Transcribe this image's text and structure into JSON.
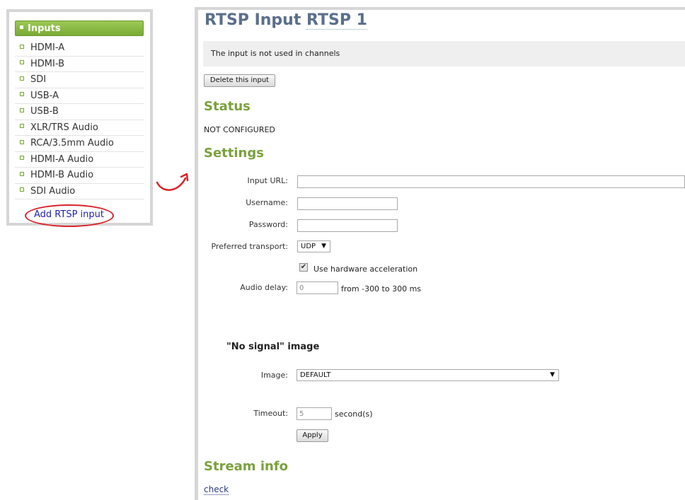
{
  "sidebar": {
    "header": "Inputs",
    "items": [
      {
        "label": "HDMI-A"
      },
      {
        "label": "HDMI-B"
      },
      {
        "label": "SDI"
      },
      {
        "label": "USB-A"
      },
      {
        "label": "USB-B"
      },
      {
        "label": "XLR/TRS Audio"
      },
      {
        "label": "RCA/3.5mm Audio"
      },
      {
        "label": "HDMI-A Audio"
      },
      {
        "label": "HDMI-B Audio"
      },
      {
        "label": "SDI Audio"
      }
    ],
    "add_link": "Add RTSP input"
  },
  "page": {
    "title_prefix": "RTSP Input",
    "title_name": "RTSP 1",
    "notice": "The input is not used in channels",
    "delete_button": "Delete this input"
  },
  "status": {
    "heading": "Status",
    "value": "NOT CONFIGURED"
  },
  "settings": {
    "heading": "Settings",
    "input_url_label": "Input URL:",
    "input_url_value": "",
    "username_label": "Username:",
    "username_value": "",
    "password_label": "Password:",
    "password_value": "",
    "transport_label": "Preferred transport:",
    "transport_value": "UDP",
    "hw_accel_label": "Use hardware acceleration",
    "hw_accel_checked": true,
    "audio_delay_label": "Audio delay:",
    "audio_delay_value": "0",
    "audio_delay_hint": "from -300 to 300 ms"
  },
  "no_signal": {
    "heading": "\"No signal\" image",
    "image_label": "Image:",
    "image_value": "DEFAULT",
    "timeout_label": "Timeout:",
    "timeout_value": "5",
    "timeout_unit": "second(s)",
    "apply_button": "Apply"
  },
  "stream_info": {
    "heading": "Stream info",
    "check_link": "check"
  },
  "colors": {
    "accent_green": "#7ba13d",
    "title_blue": "#5b6f8b",
    "highlight_red": "#d8232a"
  }
}
